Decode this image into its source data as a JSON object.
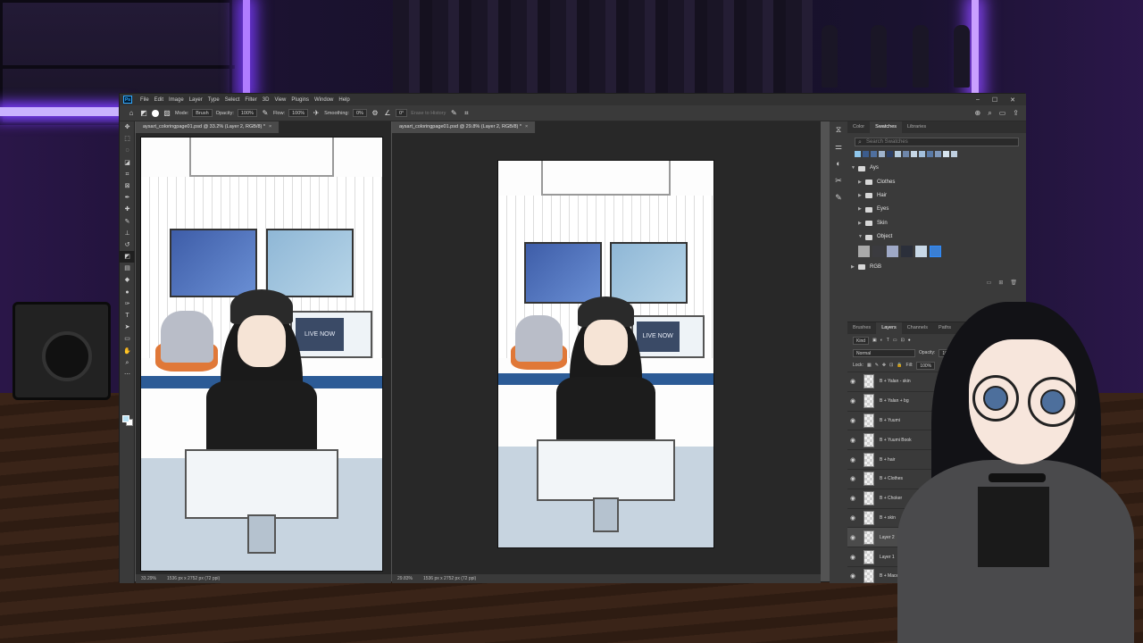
{
  "menubar": {
    "logo": "Ps",
    "items": [
      "File",
      "Edit",
      "Image",
      "Layer",
      "Type",
      "Select",
      "Filter",
      "3D",
      "View",
      "Plugins",
      "Window",
      "Help"
    ],
    "controls": [
      "–",
      "☐",
      "✕"
    ]
  },
  "options_bar": {
    "mode_label": "Mode:",
    "mode_value": "Brush",
    "opacity_label": "Opacity:",
    "opacity_value": "100%",
    "flow_label": "Flow:",
    "flow_value": "100%",
    "smoothing_label": "Smoothing:",
    "smoothing_value": "0%",
    "angle_value": "0°",
    "erase_history_label": "Erase to History"
  },
  "documents": {
    "left": {
      "tab": "aysart_coloringpage01.psd @ 33.2% (Layer 2, RGB/8) *",
      "zoom": "33.29%",
      "size": "1536 px x 2752 px (72 ppi)",
      "live_text": "LIVE NOW"
    },
    "right": {
      "tab": "aysart_coloringpage01.psd @ 29.8% (Layer 2, RGB/8) *",
      "zoom": "29.83%",
      "size": "1536 px x 2752 px (72 ppi)",
      "live_text": "LIVE NOW"
    }
  },
  "swatches_panel": {
    "tabs": [
      "Color",
      "Swatches",
      "Libraries"
    ],
    "active_tab": "Swatches",
    "search_placeholder": "Search Swatches",
    "top_colors": [
      "#8ec6ec",
      "#3c5c8c",
      "#4f6f9e",
      "#9fb3cc",
      "#2c3f66",
      "#b7cde0",
      "#6e86aa",
      "#c6d7e6",
      "#a3c0dc",
      "#5a7aa6",
      "#7f98bb",
      "#d6e3ee",
      "#bfcfe0"
    ],
    "groups": {
      "root": "Ays",
      "clothes": "Clothes",
      "hair": "Hair",
      "eyes": "Eyes",
      "skin": "Skin",
      "object": "Object",
      "rgb": "RGB"
    },
    "object_colors": [
      "#a9a9a9",
      "#3b3b3f",
      "#9fa9c7",
      "#2b2f3a",
      "#c9d9e8",
      "#3a7fd4"
    ]
  },
  "layers_panel": {
    "tabs": [
      "Brushes",
      "Layers",
      "Channels",
      "Paths"
    ],
    "active_tab": "Layers",
    "kind_label": "Kind",
    "blend_mode": "Normal",
    "opacity_label": "Opacity:",
    "opacity_value": "100%",
    "lock_label": "Lock:",
    "fill_label": "Fill:",
    "fill_value": "100%",
    "layers": [
      "B + Yalan - skin",
      "B + Yalan + bg",
      "B + Yuumi",
      "B + Yuumi Book",
      "B + hair",
      "B + Clothes",
      "B + Choker",
      "B + skin",
      "Layer 2",
      "Layer 1",
      "B + Mace Palm"
    ],
    "selected_layer": "Layer 2"
  }
}
